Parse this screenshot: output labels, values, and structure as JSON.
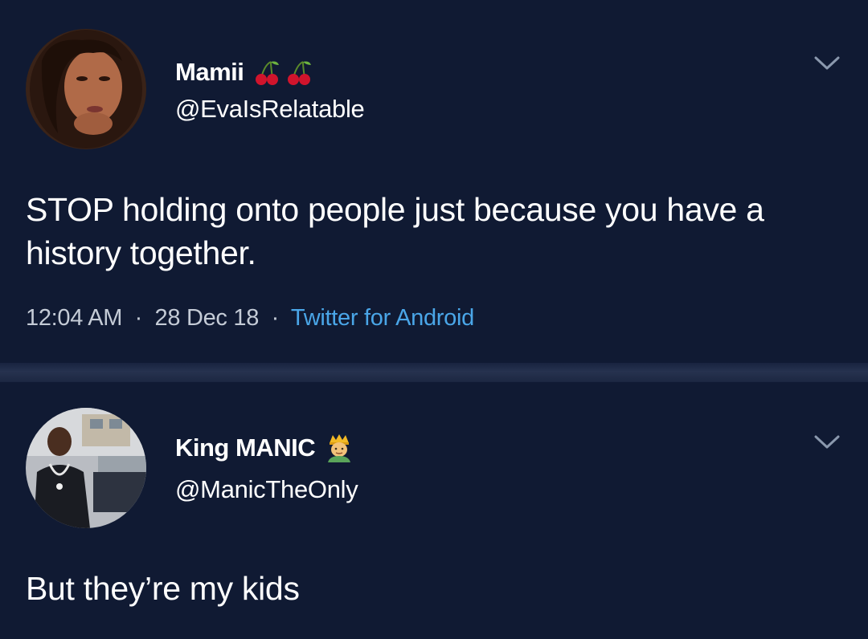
{
  "tweets": [
    {
      "display_name": "Mamii",
      "name_emoji": "cherries-icon",
      "handle": "@EvaIsRelatable",
      "text": "STOP holding onto people just because you have a history together.",
      "time": "12:04 AM",
      "date": "28 Dec 18",
      "separator": "·",
      "source": "Twitter for Android",
      "menu_icon": "chevron-down-icon"
    },
    {
      "display_name": "King MANIC",
      "name_emoji": "prince-icon",
      "handle": "@ManicTheOnly",
      "text": "But they’re my kids",
      "menu_icon": "chevron-down-icon"
    }
  ],
  "colors": {
    "background": "#101a33",
    "text": "#ffffff",
    "meta_text": "#c4cbd6",
    "link": "#4aa6e8"
  }
}
